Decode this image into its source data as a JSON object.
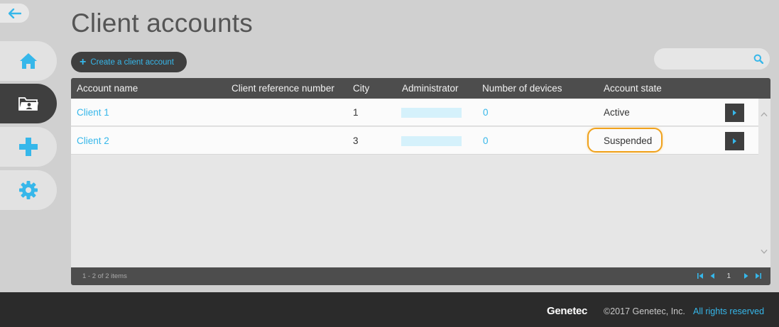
{
  "page": {
    "title": "Client accounts"
  },
  "toolbar": {
    "create_label": "Create a client account",
    "search_placeholder": ""
  },
  "table": {
    "columns": [
      "Account name",
      "Client reference number",
      "City",
      "Administrator",
      "Number of devices",
      "Account state"
    ],
    "rows": [
      {
        "account_name": "Client 1",
        "client_ref": "",
        "city": "1",
        "administrator": "",
        "devices": "0",
        "state": "Active"
      },
      {
        "account_name": "Client 2",
        "client_ref": "",
        "city": "3",
        "administrator": "",
        "devices": "0",
        "state": "Suspended"
      }
    ],
    "items_count": "1 - 2 of 2 items",
    "current_page": "1"
  },
  "footer": {
    "logo": "Genetec",
    "copyright": "©2017 Genetec, Inc.",
    "rights": "All rights reserved"
  },
  "colors": {
    "accent": "#36b7ea",
    "highlight": "#f0a21c",
    "dark": "#3f3f3f"
  },
  "icons": {
    "back": "arrow-left-icon",
    "home": "home-icon",
    "accounts": "folder-user-icon",
    "add": "plus-icon",
    "settings": "gear-icon",
    "search": "search-icon"
  }
}
